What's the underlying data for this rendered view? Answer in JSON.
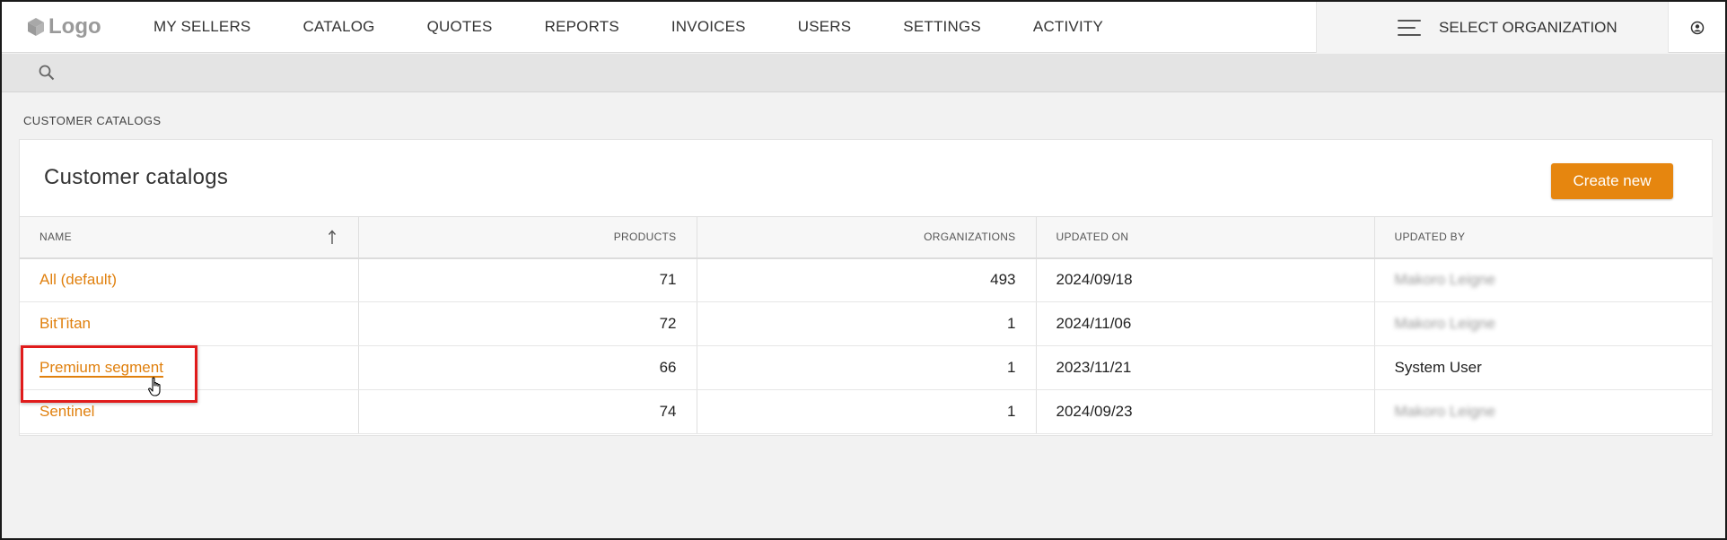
{
  "topnav": {
    "logo_text": "Logo",
    "items": [
      {
        "label": "MY SELLERS"
      },
      {
        "label": "CATALOG"
      },
      {
        "label": "QUOTES"
      },
      {
        "label": "REPORTS"
      },
      {
        "label": "INVOICES"
      },
      {
        "label": "USERS"
      },
      {
        "label": "SETTINGS"
      },
      {
        "label": "ACTIVITY"
      }
    ],
    "org_select_label": "SELECT ORGANIZATION",
    "user_icon": "user-circle-icon"
  },
  "search": {
    "icon": "search-icon"
  },
  "breadcrumb": "CUSTOMER CATALOGS",
  "card": {
    "title": "Customer catalogs",
    "create_button": "Create new"
  },
  "table": {
    "headers": [
      "NAME",
      "PRODUCTS",
      "ORGANIZATIONS",
      "UPDATED ON",
      "UPDATED BY"
    ],
    "sort_icon": "sort-ascending-icon",
    "rows": [
      {
        "name": "All (default)",
        "products": "71",
        "organizations": "493",
        "updated_on": "2024/09/18",
        "updated_by": "Makoro Leigne",
        "updated_by_blurred": true
      },
      {
        "name": "BitTitan",
        "products": "72",
        "organizations": "1",
        "updated_on": "2024/11/06",
        "updated_by": "Makoro Leigne",
        "updated_by_blurred": true
      },
      {
        "name": "Premium segment",
        "products": "66",
        "organizations": "1",
        "updated_on": "2023/11/21",
        "updated_by": "System User",
        "updated_by_blurred": false
      },
      {
        "name": "Sentinel",
        "products": "74",
        "organizations": "1",
        "updated_on": "2024/09/23",
        "updated_by": "Makoro Leigne",
        "updated_by_blurred": true
      }
    ]
  },
  "colors": {
    "accent": "#e6860f",
    "link": "#e0800e",
    "highlight": "#e01b1b"
  }
}
